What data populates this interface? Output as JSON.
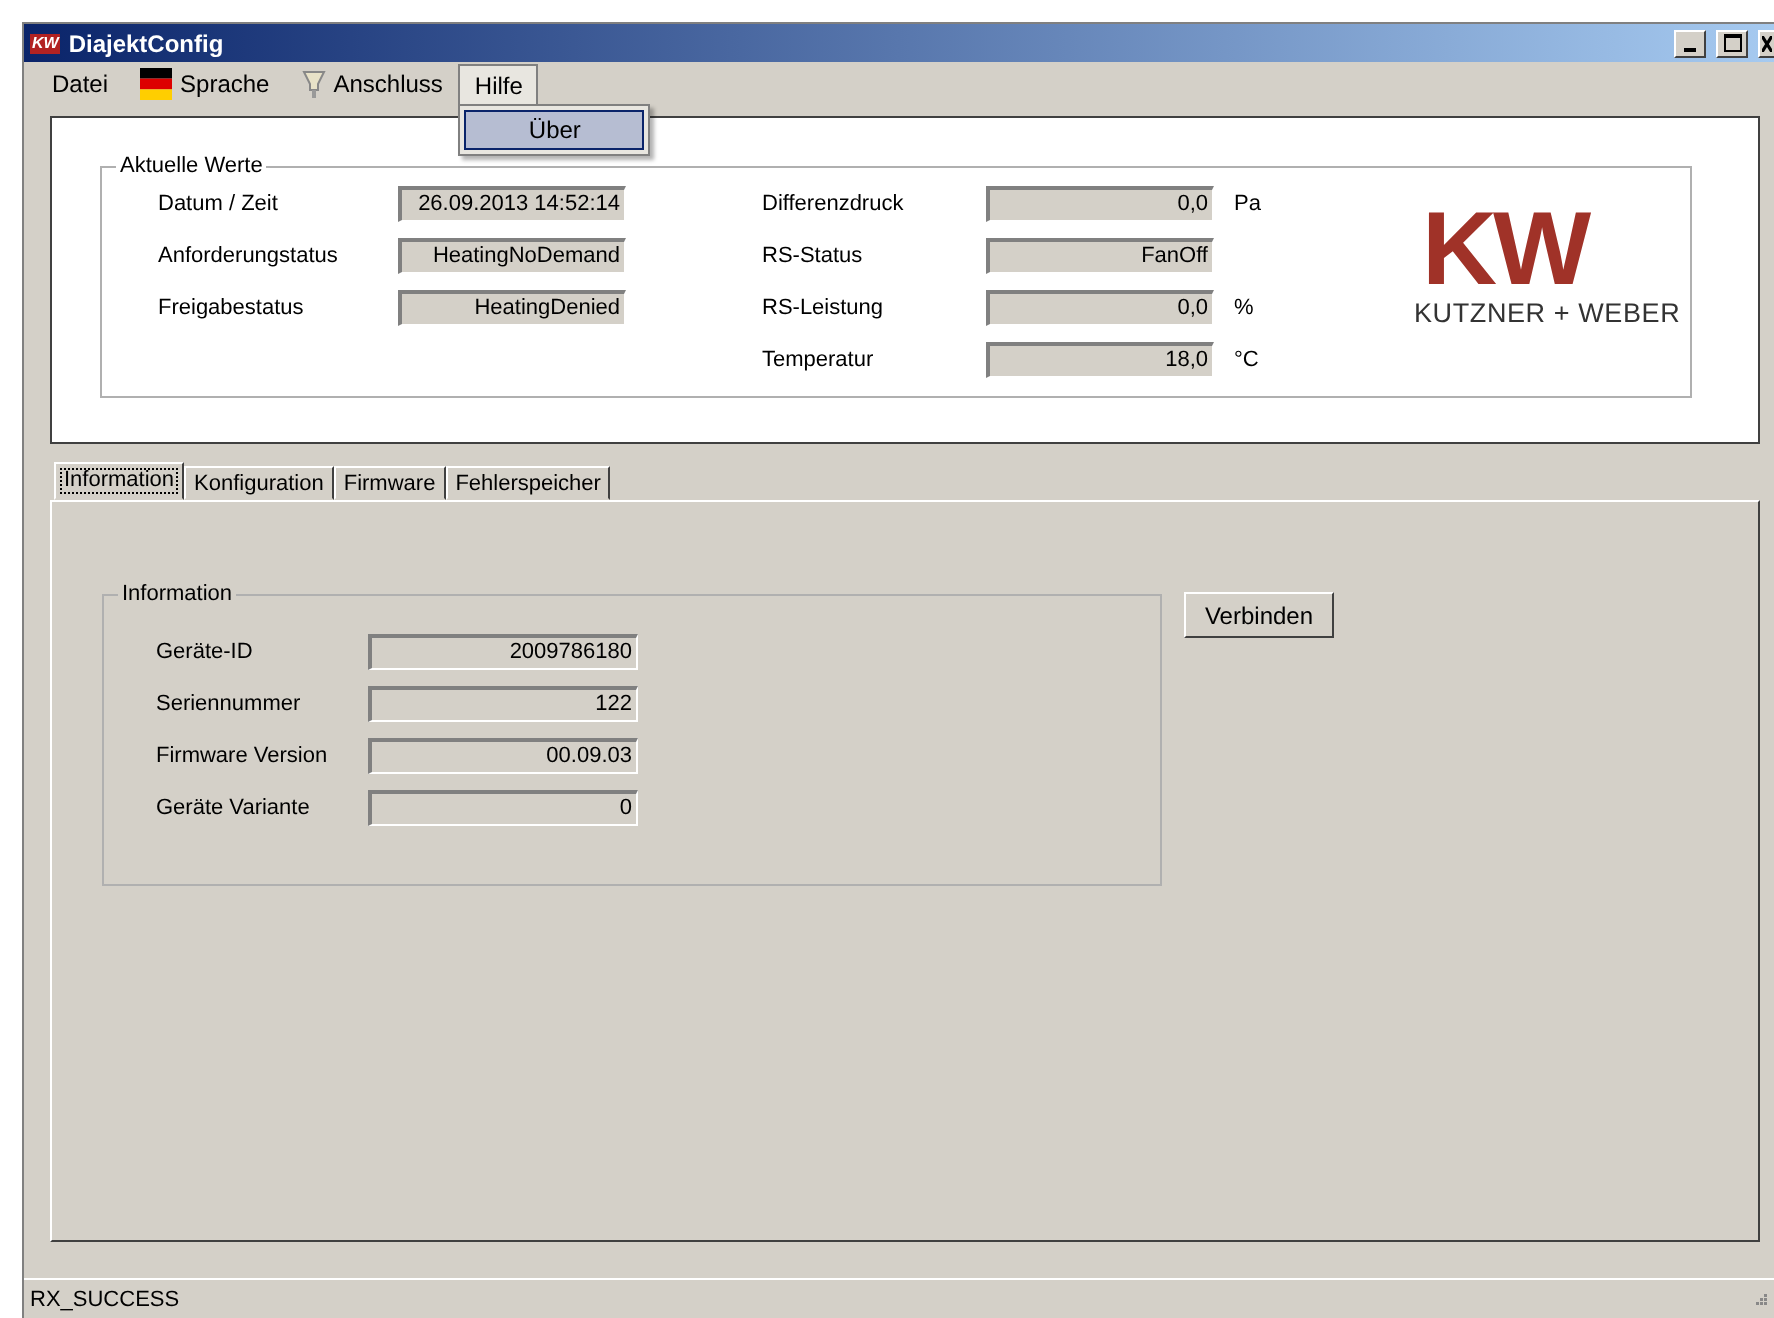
{
  "window": {
    "title": "DiajektConfig",
    "icon_text": "KW"
  },
  "menu": [
    {
      "label": "Datei",
      "kind": "plain",
      "open": false
    },
    {
      "label": "Sprache",
      "kind": "flag",
      "open": false
    },
    {
      "label": "Anschluss",
      "kind": "plug",
      "open": false
    },
    {
      "label": "Hilfe",
      "kind": "plain",
      "open": true,
      "items": [
        {
          "label": "Über",
          "selected": true
        }
      ]
    }
  ],
  "current_values": {
    "title": "Aktuelle Werte",
    "left": [
      {
        "label": "Datum / Zeit",
        "value": "26.09.2013 14:52:14"
      },
      {
        "label": "Anforderungstatus",
        "value": "HeatingNoDemand"
      },
      {
        "label": "Freigabestatus",
        "value": "HeatingDenied"
      }
    ],
    "right": [
      {
        "label": "Differenzdruck",
        "value": "0,0",
        "unit": "Pa"
      },
      {
        "label": "RS-Status",
        "value": "FanOff"
      },
      {
        "label": "RS-Leistung",
        "value": "0,0",
        "unit": "%"
      },
      {
        "label": "Temperatur",
        "value": "18,0",
        "unit": "°C"
      }
    ]
  },
  "logo": {
    "mark": "KW",
    "name": "KUTZNER + WEBER"
  },
  "tabs": [
    {
      "label": "Information",
      "selected": true
    },
    {
      "label": "Konfiguration",
      "selected": false
    },
    {
      "label": "Firmware",
      "selected": false
    },
    {
      "label": "Fehlerspeicher",
      "selected": false
    }
  ],
  "information": {
    "title": "Information",
    "fields": [
      {
        "label": "Geräte-ID",
        "value": "2009786180"
      },
      {
        "label": "Seriennummer",
        "value": "122"
      },
      {
        "label": "Firmware Version",
        "value": "00.09.03"
      },
      {
        "label": "Geräte Variante",
        "value": "0"
      }
    ],
    "connect_button": "Verbinden"
  },
  "status_bar": {
    "text": "RX_SUCCESS"
  }
}
